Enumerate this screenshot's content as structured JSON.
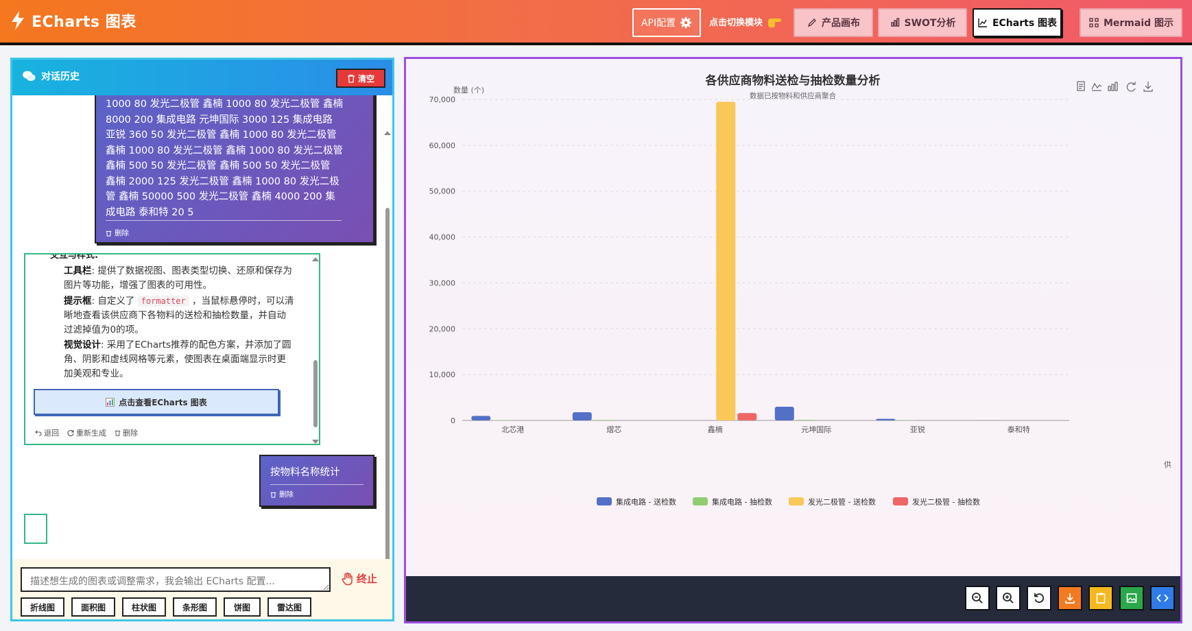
{
  "app": {
    "title": "ECharts 图表"
  },
  "topbar": {
    "api_label": "API配置",
    "switch_hint": "点击切换模块",
    "tabs": [
      {
        "label": "产品画布",
        "icon": "pen-icon",
        "active": false
      },
      {
        "label": "SWOT分析",
        "icon": "bar-chart-icon",
        "active": false
      },
      {
        "label": "ECharts 图表",
        "icon": "chart-line-icon",
        "active": true
      },
      {
        "label": "Mermaid 图示",
        "icon": "diagram-icon",
        "active": false
      }
    ]
  },
  "history": {
    "title": "对话历史",
    "clear_label": "清空",
    "user_message_1": {
      "lines": [
        "1000 80 发光二极管 鑫楠 1000 80 发光二极管 鑫楠",
        "8000 200 集成电路 元坤国际 3000 125 集成电路",
        "亚锐 360 50 发光二极管 鑫楠 1000 80 发光二极管",
        "鑫楠 1000 80 发光二极管 鑫楠 1000 80 发光二极管",
        "鑫楠 500 50 发光二极管 鑫楠 500 50 发光二极管",
        "鑫楠 2000 125 发光二极管 鑫楠 1000 80 发光二极",
        "管 鑫楠 50000 500 发光二极管 鑫楠 4000 200 集",
        "成电路 泰和特 20 5"
      ],
      "delete_label": "删除"
    },
    "ai_message": {
      "cut_heading": "交互与样式:",
      "p1_bold": "工具栏",
      "p1_text": ": 提供了数据视图、图表类型切换、还原和保存为图片等功能，增强了图表的可用性。",
      "p2_bold": "提示框",
      "p2_pre": ": 自定义了 ",
      "p2_code": "formatter",
      "p2_post": " ，当鼠标悬停时，可以清晰地查看该供应商下各物料的送检和抽检数量，并自动过滤掉值为0的项。",
      "p3_bold": "视觉设计",
      "p3_text": ": 采用了ECharts推荐的配色方案，并添加了圆角、阴影和虚线网格等元素，使图表在桌面端显示时更加美观和专业。",
      "view_button": "点击查看ECharts 图表",
      "actions": [
        "退回",
        "重新生成",
        "删除"
      ]
    },
    "user_message_2": {
      "text": "按物料名称统计",
      "delete_label": "删除"
    }
  },
  "input": {
    "placeholder": "描述想生成的图表或调整需求，我会输出 ECharts 配置...",
    "stop_label": "终止",
    "chips": [
      "折线图",
      "面积图",
      "柱状图",
      "条形图",
      "饼图",
      "雷达图"
    ]
  },
  "colors": {
    "series1": "#5470c6",
    "series2": "#91cc75",
    "series3": "#fac858",
    "series4": "#ee6666"
  },
  "chart_data": {
    "type": "bar",
    "title": "各供应商物料送检与抽检数量分析",
    "subtitle": "数据已按物料和供应商聚合",
    "ylabel": "数量 (个)",
    "xlabel": "供",
    "ylim": [
      0,
      70000
    ],
    "yticks": [
      "0",
      "10,000",
      "20,000",
      "30,000",
      "40,000",
      "50,000",
      "60,000",
      "70,000"
    ],
    "categories": [
      "北芯港",
      "熠芯",
      "鑫楠",
      "元坤国际",
      "亚锐",
      "泰和特"
    ],
    "series": [
      {
        "name": "集成电路 - 送检数",
        "values": [
          1000,
          1800,
          0,
          3000,
          360,
          20
        ]
      },
      {
        "name": "集成电路 - 抽检数",
        "values": [
          80,
          120,
          0,
          125,
          50,
          5
        ]
      },
      {
        "name": "发光二极管 - 送检数",
        "values": [
          0,
          0,
          69500,
          0,
          0,
          0
        ]
      },
      {
        "name": "发光二极管 - 抽检数",
        "values": [
          0,
          0,
          1600,
          0,
          0,
          0
        ]
      }
    ],
    "legend_position": "bottom",
    "grid": true
  }
}
